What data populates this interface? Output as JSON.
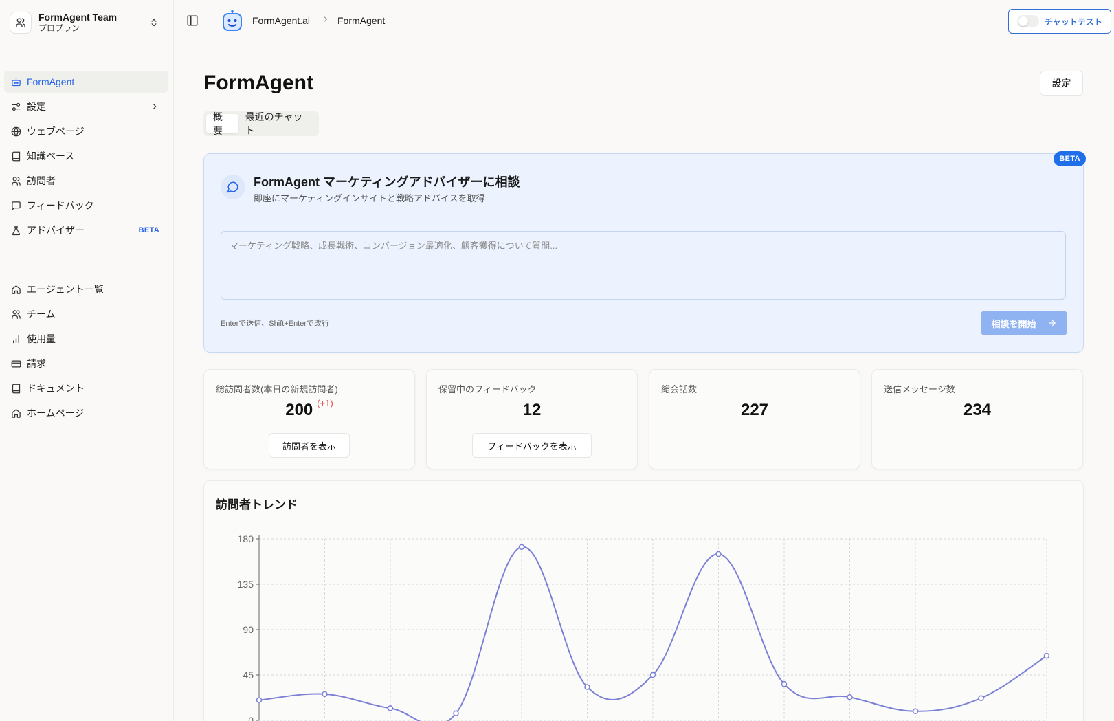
{
  "team": {
    "name": "FormAgent Team",
    "plan": "プロプラン"
  },
  "sidebar": {
    "primary": [
      {
        "label": "FormAgent",
        "icon": "bot-icon",
        "active": true
      },
      {
        "label": "設定",
        "icon": "sliders-icon",
        "chevron": true
      },
      {
        "label": "ウェブページ",
        "icon": "globe-icon"
      },
      {
        "label": "知識ベース",
        "icon": "book-icon"
      },
      {
        "label": "訪問者",
        "icon": "users-icon"
      },
      {
        "label": "フィードバック",
        "icon": "message-square-icon"
      },
      {
        "label": "アドバイザー",
        "icon": "flask-icon",
        "badge": "BETA"
      }
    ],
    "secondary": [
      {
        "label": "エージェント一覧",
        "icon": "home-icon"
      },
      {
        "label": "チーム",
        "icon": "users-icon"
      },
      {
        "label": "使用量",
        "icon": "bar-chart-icon"
      },
      {
        "label": "請求",
        "icon": "credit-card-icon"
      },
      {
        "label": "ドキュメント",
        "icon": "book-icon"
      },
      {
        "label": "ホームページ",
        "icon": "home-icon"
      }
    ]
  },
  "header": {
    "breadcrumb": [
      "FormAgent.ai",
      "FormAgent"
    ],
    "chat_test_label": "チャットテスト"
  },
  "main": {
    "title": "FormAgent",
    "settings_label": "設定",
    "tabs": [
      {
        "label": "概要",
        "active": true
      },
      {
        "label": "最近のチャット",
        "active": false
      }
    ]
  },
  "advisor": {
    "badge": "BETA",
    "title": "FormAgent マーケティングアドバイザーに相談",
    "subtitle": "即座にマーケティングインサイトと戦略アドバイスを取得",
    "placeholder": "マーケティング戦略、成長戦術、コンバージョン最適化、顧客獲得について質問...",
    "hint": "Enterで送信、Shift+Enterで改行",
    "start_label": "相談を開始"
  },
  "stats": [
    {
      "label": "総訪問者数(本日の新規訪問者)",
      "value": "200",
      "delta": "(+1)",
      "button": "訪問者を表示"
    },
    {
      "label": "保留中のフィードバック",
      "value": "12",
      "button": "フィードバックを表示"
    },
    {
      "label": "総会話数",
      "value": "227"
    },
    {
      "label": "送信メッセージ数",
      "value": "234"
    }
  ],
  "chart_data": {
    "type": "line",
    "title": "訪問者トレンド",
    "y_ticks": [
      "180",
      "135",
      "90",
      "45",
      "0"
    ],
    "ylim": [
      0,
      180
    ],
    "x_index": [
      0,
      1,
      2,
      3,
      4,
      5,
      6,
      7,
      8,
      9,
      10,
      11,
      12
    ],
    "values": [
      20,
      26,
      12,
      7,
      172,
      33,
      45,
      165,
      36,
      23,
      9,
      22,
      64
    ],
    "grid": true,
    "color": "#7b80d6"
  }
}
